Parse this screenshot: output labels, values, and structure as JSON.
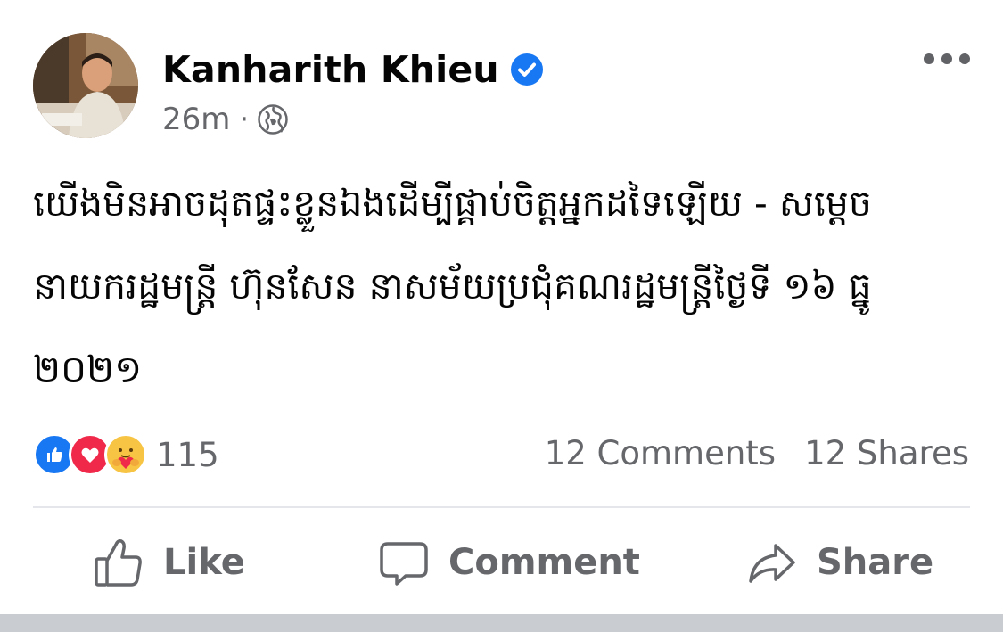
{
  "post": {
    "author": "Kanharith Khieu",
    "time": "26m",
    "separator": "·",
    "text": "យើងមិនអាចដុតផ្ទះខ្លួនឯងដើម្បីផ្គាប់ចិត្តអ្នកដទៃឡើយ - សម្តេច\nនាយករដ្ឋមន្ត្រី ហ៊ុនសែន នាសម័យប្រជុំគណរដ្ឋមន្ត្រីថ្ងៃទី ១៦ ធ្នូ\n២០២១"
  },
  "engagement": {
    "reaction_count": "115",
    "comments": "12 Comments",
    "shares": "12 Shares"
  },
  "actions": {
    "like": "Like",
    "comment": "Comment",
    "share": "Share"
  },
  "icons": [
    "avatar",
    "verified-badge-icon",
    "globe-icon",
    "more-options-icon",
    "like-reaction-icon",
    "love-reaction-icon",
    "care-reaction-icon",
    "thumbs-up-icon",
    "comment-bubble-icon",
    "share-arrow-icon"
  ],
  "colors": {
    "accent": "#1877f2",
    "muted": "#65676b",
    "love": "#f0284a",
    "care": "#f7c443"
  }
}
